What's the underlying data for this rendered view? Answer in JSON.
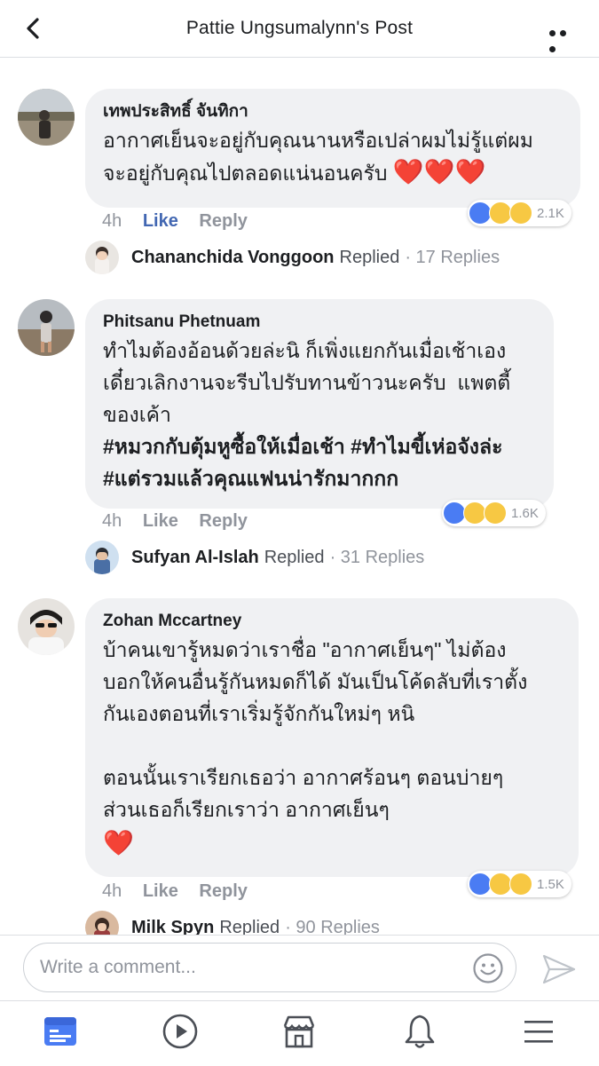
{
  "header": {
    "title": "Pattie Ungsumalynn's Post"
  },
  "comments": [
    {
      "author": "เทพประสิทธิ์ จันทิกา",
      "text": "อากาศเย็นจะอยู่กับคุณนานหรือเปล่าผมไม่รู้แต่ผม\nจะอยู่กับคุณไปตลอดแน่นอนครับ",
      "hearts": "❤️❤️❤️",
      "time": "4h",
      "like": "Like",
      "reply": "Reply",
      "reaction_count": "2.1K",
      "reactions": [
        "like",
        "haha",
        "wow"
      ],
      "replied_by": "Chananchida Vonggoon",
      "replied_word": "Replied",
      "replies": "· 17 Replies"
    },
    {
      "author": "Phitsanu Phetnuam",
      "text": "ทำไมต้องอ้อนด้วยล่ะนิ ก็เพิ่งแยกกันเมื่อเช้าเอง\nเดี๋ยวเลิกงานจะรีบไปรับทานข้าวนะครับ  แพตตี้\nของเค้า",
      "hashtags": "#หมวกกับตุ้มหูซื้อให้เมื่อเช้า #ทำไมขี้เห่อจังล่ะ\n#แต่รวมแล้วคุณแฟนน่ารักมากกก",
      "time": "4h",
      "like": "Like",
      "reply": "Reply",
      "reaction_count": "1.6K",
      "reactions": [
        "like",
        "haha",
        "wow"
      ],
      "replied_by": "Sufyan Al-Islah",
      "replied_word": "Replied",
      "replies": "· 31 Replies"
    },
    {
      "author": "Zohan Mccartney",
      "text": "บ้าคนเขารู้หมดว่าเราชื่อ \"อากาศเย็นๆ\" ไม่ต้อง\nบอกให้คนอื่นรู้กันหมดก็ได้ มันเป็นโค้ดลับที่เราตั้ง\nกันเองตอนที่เราเริ่มรู้จักกันใหม่ๆ หนิ\n\nตอนนั้นเราเรียกเธอว่า อากาศร้อนๆ ตอนบ่ายๆ\nส่วนเธอก็เรียกเราว่า อากาศเย็นๆ",
      "hearts": "❤️",
      "time": "4h",
      "like": "Like",
      "reply": "Reply",
      "reaction_count": "1.5K",
      "reactions": [
        "like",
        "haha",
        "sad"
      ],
      "replied_by": "Milk Spyn",
      "replied_word": "Replied",
      "replies": "· 90 Replies"
    }
  ],
  "composer": {
    "placeholder": "Write a comment..."
  },
  "colors": {
    "accent": "#4267b2",
    "bubble": "#f0f1f3",
    "muted": "#90949c",
    "heart": "#e0282e"
  },
  "icons": {
    "back": "chevron-left-icon",
    "more": "more-dots-icon",
    "emoji": "smiley-icon",
    "send": "send-arrow-icon",
    "tabs": [
      "news-feed-icon",
      "video-play-icon",
      "marketplace-store-icon",
      "notifications-bell-icon",
      "menu-hamburger-icon"
    ]
  }
}
